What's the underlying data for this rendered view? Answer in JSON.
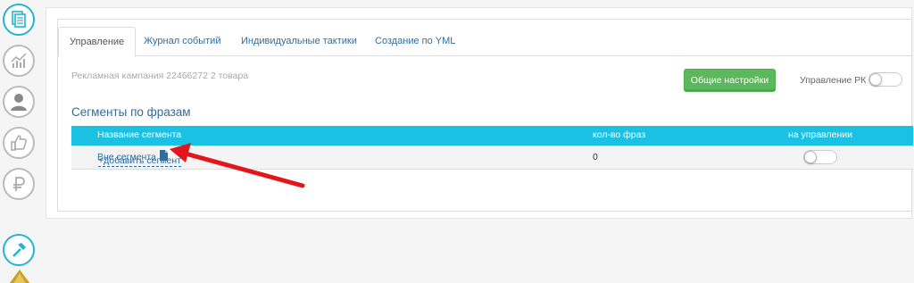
{
  "tabs": [
    {
      "label": "Управление",
      "active": true
    },
    {
      "label": "Журнал событий"
    },
    {
      "label": "Индивидуальные тактики"
    },
    {
      "label": "Создание по YML"
    }
  ],
  "campaign_text": "Рекламная кампания 22466272 2 товара",
  "general_settings_label": "Общие настройки",
  "rk_control_label": "Управление РК",
  "rk_control_enabled": false,
  "segments_title": "Сегменты по фразам",
  "table": {
    "columns": [
      "Название сегмента",
      "кол-во фраз",
      "на управлении"
    ],
    "rows": [
      {
        "name": "Вне сегмента",
        "count": "0",
        "managed": false
      }
    ]
  },
  "add_segment_label": "+добавить сегмент",
  "colors": {
    "accent": "#1bc1e3",
    "button": "#5cb85c",
    "link": "#2e6da4",
    "arrow": "#e3161c"
  },
  "icons": [
    "documents-icon",
    "chart-icon",
    "user-icon",
    "thumbs-up-icon",
    "ruble-icon",
    "hammer-icon",
    "logo-icon",
    "file-icon"
  ]
}
